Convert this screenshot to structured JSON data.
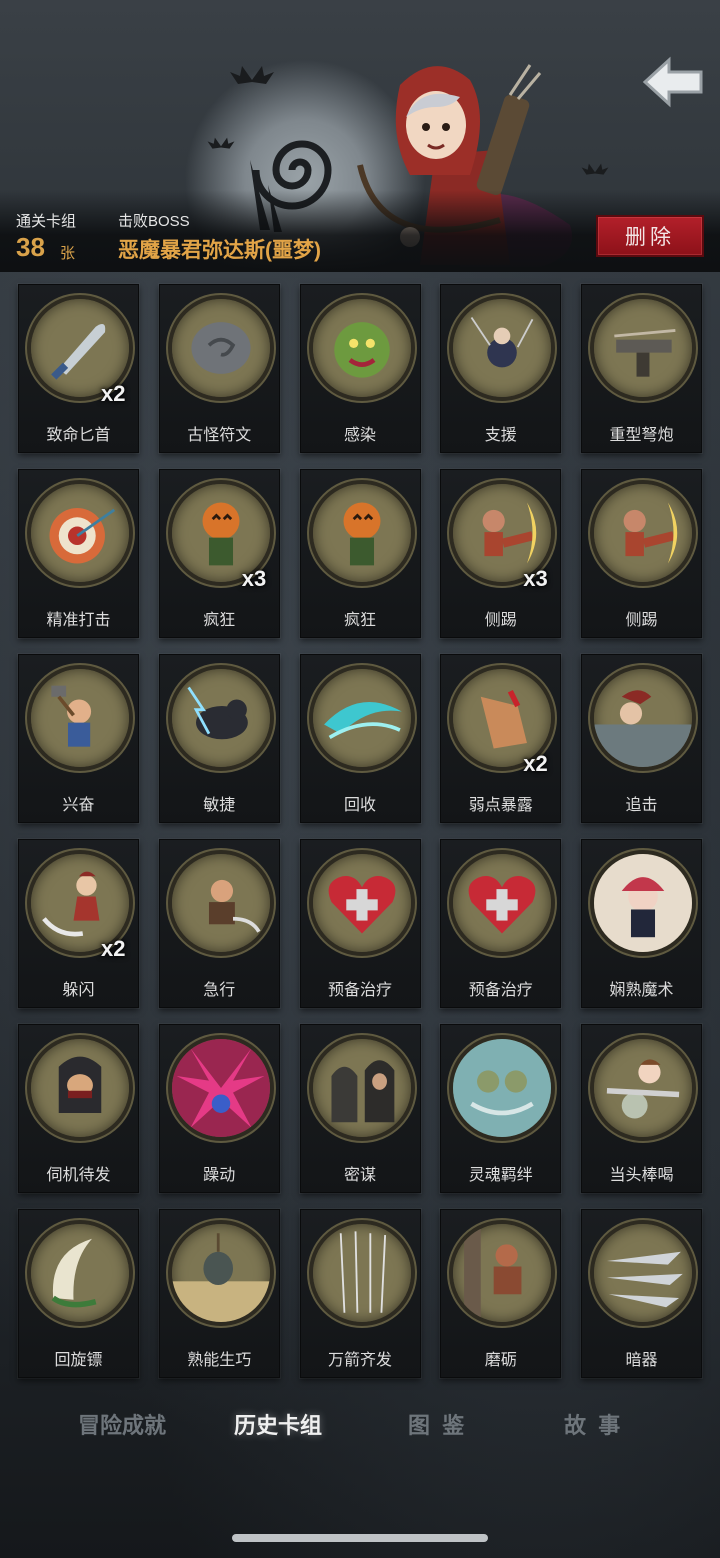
{
  "header": {
    "cleared_deck_label": "通关卡组",
    "card_count": "38",
    "card_unit": "张",
    "defeated_boss_label": "击败BOSS",
    "boss_name": "恶魔暴君弥达斯(噩梦)",
    "delete_label": "删除"
  },
  "cards": [
    {
      "name": "致命匕首",
      "count": "x2",
      "icon": "dagger-icon",
      "color": "#7a7551"
    },
    {
      "name": "古怪符文",
      "count": "",
      "icon": "rune-stone-icon",
      "color": "#7a7551"
    },
    {
      "name": "感染",
      "count": "",
      "icon": "infected-monster-icon",
      "color": "#7a7551"
    },
    {
      "name": "支援",
      "count": "",
      "icon": "support-archers-icon",
      "color": "#7a7551"
    },
    {
      "name": "重型弩炮",
      "count": "",
      "icon": "ballista-icon",
      "color": "#7a7551"
    },
    {
      "name": "精准打击",
      "count": "",
      "icon": "target-icon",
      "color": "#7a7551"
    },
    {
      "name": "疯狂",
      "count": "x3",
      "icon": "pumpkin-head-icon",
      "color": "#7a7551"
    },
    {
      "name": "疯狂",
      "count": "",
      "icon": "pumpkin-head-icon",
      "color": "#7a7551"
    },
    {
      "name": "侧踢",
      "count": "x3",
      "icon": "side-kick-icon",
      "color": "#7a7551"
    },
    {
      "name": "侧踢",
      "count": "",
      "icon": "side-kick-icon",
      "color": "#7a7551"
    },
    {
      "name": "兴奋",
      "count": "",
      "icon": "hammer-dwarf-icon",
      "color": "#7a7551"
    },
    {
      "name": "敏捷",
      "count": "",
      "icon": "panther-icon",
      "color": "#7a7551"
    },
    {
      "name": "回收",
      "count": "",
      "icon": "wave-slash-icon",
      "color": "#7a7551"
    },
    {
      "name": "弱点暴露",
      "count": "x2",
      "icon": "foot-wound-icon",
      "color": "#7a7551"
    },
    {
      "name": "追击",
      "count": "",
      "icon": "pursuit-icon",
      "color": "#7a7551"
    },
    {
      "name": "躲闪",
      "count": "x2",
      "icon": "dodge-girl-icon",
      "color": "#7a7551"
    },
    {
      "name": "急行",
      "count": "",
      "icon": "dash-warrior-icon",
      "color": "#7a7551"
    },
    {
      "name": "预备治疗",
      "count": "",
      "icon": "heal-heart-icon",
      "color": "#7a7551"
    },
    {
      "name": "预备治疗",
      "count": "",
      "icon": "heal-heart-icon",
      "color": "#7a7551"
    },
    {
      "name": "娴熟魔术",
      "count": "",
      "icon": "magician-icon",
      "color": "#7a7551"
    },
    {
      "name": "伺机待发",
      "count": "",
      "icon": "hooded-assassin-icon",
      "color": "#7a7551"
    },
    {
      "name": "躁动",
      "count": "",
      "icon": "frenzy-burst-icon",
      "color": "#7a7551"
    },
    {
      "name": "密谋",
      "count": "",
      "icon": "conspiracy-icon",
      "color": "#7a7551"
    },
    {
      "name": "灵魂羁绊",
      "count": "",
      "icon": "soul-bond-icon",
      "color": "#7a7551"
    },
    {
      "name": "当头棒喝",
      "count": "",
      "icon": "head-strike-icon",
      "color": "#7a7551"
    },
    {
      "name": "回旋镖",
      "count": "",
      "icon": "boomerang-icon",
      "color": "#7a7551"
    },
    {
      "name": "熟能生巧",
      "count": "",
      "icon": "practice-target-icon",
      "color": "#7a7551"
    },
    {
      "name": "万箭齐发",
      "count": "",
      "icon": "arrow-rain-icon",
      "color": "#7a7551"
    },
    {
      "name": "磨砺",
      "count": "",
      "icon": "sharpen-warrior-icon",
      "color": "#7a7551"
    },
    {
      "name": "暗器",
      "count": "",
      "icon": "throwing-knives-icon",
      "color": "#7a7551"
    }
  ],
  "tabs": [
    {
      "label": "冒险成就",
      "active": false
    },
    {
      "label": "历史卡组",
      "active": true
    },
    {
      "label": "图  鉴",
      "active": false
    },
    {
      "label": "故  事",
      "active": false
    }
  ],
  "colors": {
    "accent_gold": "#d9a24a",
    "delete_red": "#a61a23",
    "card_art_bg": "#7d7653"
  }
}
